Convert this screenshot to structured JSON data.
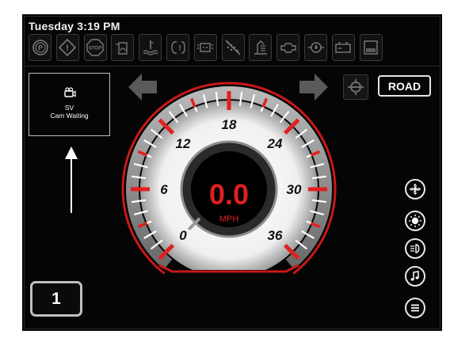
{
  "status": {
    "datetime": "Tuesday 3:19 PM"
  },
  "telltales": [
    {
      "name": "parking-brake-icon",
      "label": "(P)"
    },
    {
      "name": "warning-icon",
      "label": "!"
    },
    {
      "name": "stop-icon",
      "label": "STOP"
    },
    {
      "name": "fuel-filter-icon",
      "label": ""
    },
    {
      "name": "coolant-temp-icon",
      "label": ""
    },
    {
      "name": "glow-plug-icon",
      "label": ""
    },
    {
      "name": "engine-check-icon",
      "label": ""
    },
    {
      "name": "regen-inhibit-icon",
      "label": ""
    },
    {
      "name": "exhaust-temp-icon",
      "label": ""
    },
    {
      "name": "engine-oil-icon",
      "label": ""
    },
    {
      "name": "water-in-fuel-icon",
      "label": ""
    },
    {
      "name": "battery-icon",
      "label": ""
    },
    {
      "name": "fluid-level-icon",
      "label": ""
    }
  ],
  "camera": {
    "line1": "SV",
    "line2": "Cam Waiting"
  },
  "drive_mode": {
    "label": "ROAD"
  },
  "gear": {
    "value": "1"
  },
  "speedometer": {
    "value": "0.0",
    "unit": "MPH",
    "ticks": [
      "0",
      "6",
      "12",
      "18",
      "24",
      "30",
      "36"
    ],
    "min": 0,
    "max": 36,
    "current": 0
  },
  "side_controls": [
    {
      "name": "fan-icon"
    },
    {
      "name": "brightness-icon"
    },
    {
      "name": "headlight-icon"
    },
    {
      "name": "music-icon"
    },
    {
      "name": "menu-icon"
    }
  ],
  "colors": {
    "accent": "#e02020",
    "background": "#050505",
    "foreground": "#ffffff"
  }
}
